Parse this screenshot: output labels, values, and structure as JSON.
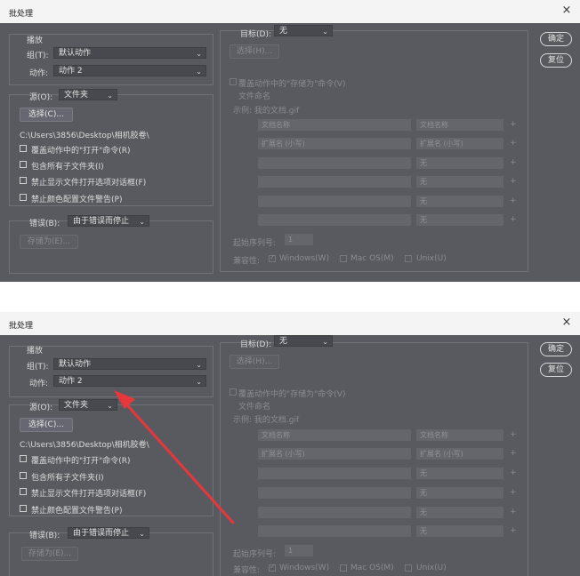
{
  "dialog": {
    "title": "批处理",
    "close_glyph": "×",
    "play_label": "播放",
    "group_label": "组(T):",
    "group_value": "默认动作",
    "action_label": "动作:",
    "action_value": "动作 2",
    "source_label": "源(O):",
    "source_value": "文件夹",
    "choose_button": "选择(C)...",
    "path": "C:\\Users\\3856\\Desktop\\相机胶卷\\",
    "options": [
      "覆盖动作中的\"打开\"命令(R)",
      "包含所有子文件夹(I)",
      "禁止显示文件打开选项对话框(F)",
      "禁止颜色配置文件警告(P)"
    ],
    "error_label": "错误(B):",
    "error_value": "由于错误而停止",
    "save_as_button": "存储为(E)...",
    "target_label": "目标(D):",
    "target_value": "无",
    "select_button": "选择(H)...",
    "override_save": "覆盖动作中的\"存储为\"命令(V)",
    "naming_label": "文件命名",
    "example": "示例: 我的文档.gif",
    "naming_left": [
      "文档名称",
      "扩展名 (小写)",
      "",
      "",
      "",
      ""
    ],
    "naming_right": [
      "文档名称",
      "扩展名 (小写)",
      "无",
      "无",
      "无",
      "无"
    ],
    "plus": "+",
    "serial_label": "起始序列号:",
    "serial_value": "1",
    "compat_label": "兼容性:",
    "compat_windows": "Windows(W)",
    "compat_mac": "Mac OS(M)",
    "compat_unix": "Unix(U)",
    "ok_button": "确定",
    "reset_button": "复位",
    "dropdown_glyph": "⌄"
  },
  "colors": {
    "panel": "#595a60",
    "arrow": "#e8373a"
  }
}
